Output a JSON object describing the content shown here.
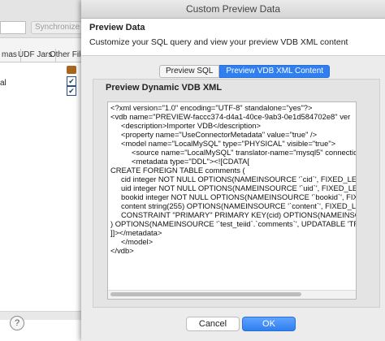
{
  "background": {
    "sync_button_label": "Synchronize A",
    "tabs": [
      "mas",
      "UDF Jars",
      "Other Files"
    ],
    "row_label": "al"
  },
  "dialog": {
    "title": "Custom Preview Data",
    "header_title": "Preview Data",
    "header_description": "Customize your SQL query and view your preview VDB XML content",
    "tabs": [
      {
        "label": "Preview SQL",
        "active": false
      },
      {
        "label": "Preview VDB XML Content",
        "active": true
      }
    ],
    "panel_title": "Preview Dynamic VDB XML",
    "xml_content": "<?xml version=\"1.0\" encoding=\"UTF-8\" standalone=\"yes\"?>\n<vdb name=\"PREVIEW-faccc374-d4a1-40ce-9ab3-0e1d584702e8\" ver\n     <description>Importer VDB</description>\n     <property name=\"UseConnectorMetadata\" value=\"true\" />\n     <model name=\"LocalMySQL\" type=\"PHYSICAL\" visible=\"true\">\n          <source name=\"LocalMySQL\" translator-name=\"mysql5\" connection\n          <metadata type=\"DDL\"><![CDATA[\nCREATE FOREIGN TABLE comments (\n     cid integer NOT NULL OPTIONS(NAMEINSOURCE '`cid`', FIXED_LENGT\n     uid integer NOT NULL OPTIONS(NAMEINSOURCE '`uid`', FIXED_LENGTH 'TRUE'),\n     bookid integer NOT NULL OPTIONS(NAMEINSOURCE '`bookid`', FIXED\n     content string(255) OPTIONS(NAMEINSOURCE '`content`', FIXED_LENG\n     CONSTRAINT \"PRIMARY\" PRIMARY KEY(cid) OPTIONS(NAMEINSOURCE\n) OPTIONS(NAMEINSOURCE '`test_teiid`.`comments`', UPDATABLE 'TRUE'\n]]></metadata>\n     </model>\n</vdb>",
    "help_label": "?",
    "cancel_label": "Cancel",
    "ok_label": "OK"
  },
  "colors": {
    "accent": "#2f7ff0",
    "dialog_background": "#ececec",
    "header_background": "#ffffff"
  }
}
